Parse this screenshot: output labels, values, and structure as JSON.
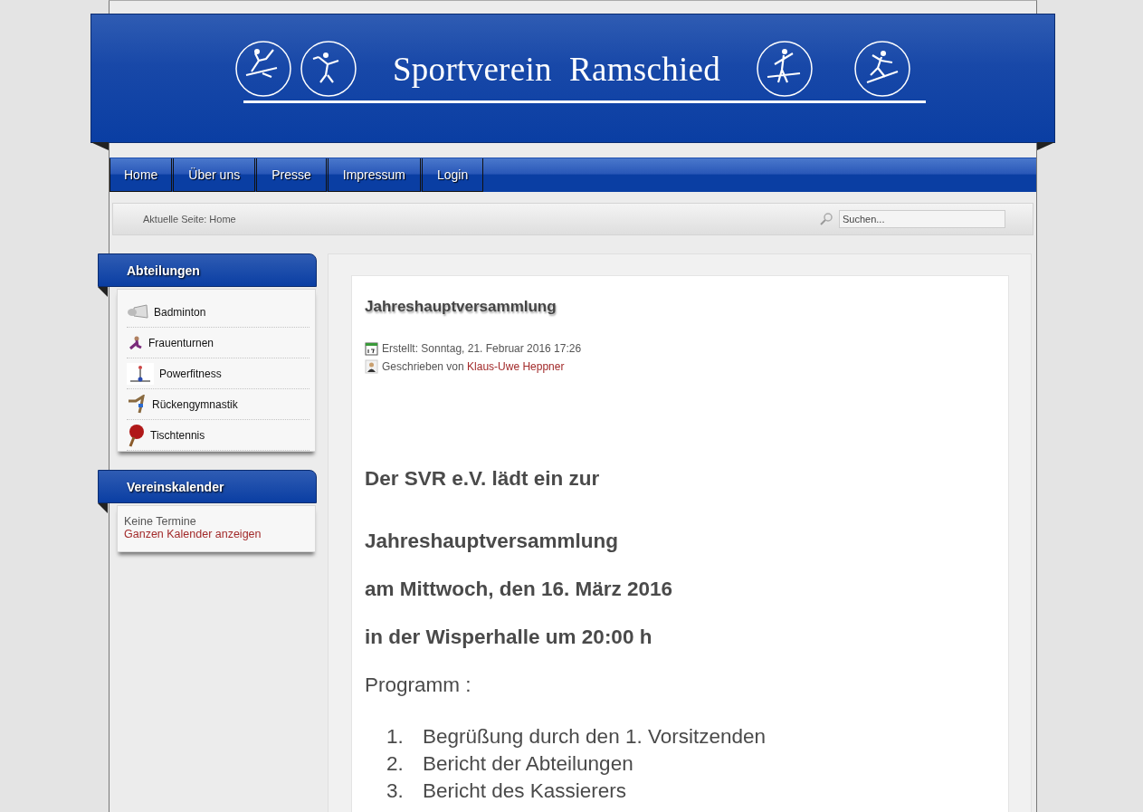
{
  "header": {
    "title": "Sportverein  Ramschied"
  },
  "nav": [
    {
      "label": "Home"
    },
    {
      "label": "Über uns"
    },
    {
      "label": "Presse"
    },
    {
      "label": "Impressum"
    },
    {
      "label": "Login"
    }
  ],
  "breadcrumb": "Aktuelle Seite: Home",
  "search": {
    "placeholder": "Suchen..."
  },
  "sidebar": [
    {
      "kind": "menu",
      "title": "Abteilungen",
      "items": [
        {
          "label": "Badminton"
        },
        {
          "label": "Frauenturnen"
        },
        {
          "label": "Powerfitness"
        },
        {
          "label": "Rückengymnastik"
        },
        {
          "label": "Tischtennis"
        }
      ]
    },
    {
      "kind": "calendar",
      "title": "Vereinskalender",
      "text": "Keine Termine",
      "link": "Ganzen Kalender anzeigen"
    }
  ],
  "article": {
    "title": "Jahreshauptversammlung",
    "created": "Erstellt: Sonntag, 21. Februar 2016 17:26",
    "author_prefix": "Geschrieben von",
    "author": "Klaus-Uwe Heppner",
    "headings": [
      "Der SVR e.V. lädt ein zur",
      "Jahreshauptversammlung",
      "am Mittwoch, den 16. März 2016",
      "in der Wisperhalle um 20:00 h"
    ],
    "program_label": "Programm :",
    "agenda": [
      {
        "number": "1.",
        "text": "Begrüßung durch den 1. Vorsitzenden"
      },
      {
        "number": "2.",
        "text": "Bericht der Abteilungen"
      },
      {
        "number": "3.",
        "text": "Bericht des Kassierers"
      }
    ]
  }
}
